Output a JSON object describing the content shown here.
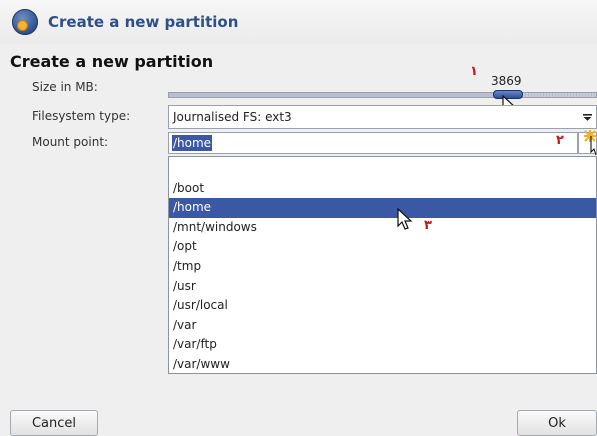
{
  "window": {
    "title": "Create a new partition"
  },
  "dialog": {
    "heading": "Create a new partition",
    "size_label": "Size in MB:",
    "size_value": "3869",
    "size_fill_fraction": 0.79,
    "filesystem_label": "Filesystem type:",
    "filesystem_value": "Journalised FS: ext3",
    "mount_label": "Mount point:",
    "mount_value": "/home"
  },
  "mount_options": [
    "",
    "/boot",
    "/home",
    "/mnt/windows",
    "/opt",
    "/tmp",
    "/usr",
    "/usr/local",
    "/var",
    "/var/ftp",
    "/var/www"
  ],
  "selected_mount_index": 2,
  "annotations": {
    "one": "١",
    "two": "٢",
    "three": "٣"
  },
  "buttons": {
    "cancel": "Cancel",
    "ok": "Ok"
  },
  "colors": {
    "accent": "#3a58a6",
    "title": "#2d4f8a",
    "annotation": "#c31818"
  },
  "icons": {
    "app": "partition-disk-icon",
    "dropdown": "chevron-down-icon",
    "cursor": "mouse-pointer-icon"
  }
}
